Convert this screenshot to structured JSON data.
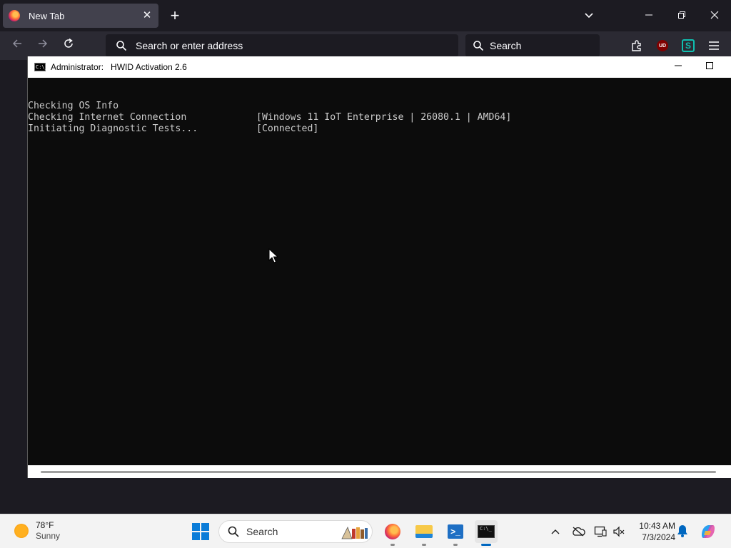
{
  "browser": {
    "tab_title": "New Tab",
    "url_placeholder": "Search or enter address",
    "search_placeholder": "Search",
    "ublock_label": "UD",
    "s_ext_label": "S"
  },
  "console": {
    "title_prefix": "Administrator:",
    "title": "HWID Activation 2.6",
    "icon_label": "C:\\_",
    "lines": [
      {
        "label": "Checking OS Info",
        "value": "[Windows 11 IoT Enterprise | 26080.1 | AMD64]"
      },
      {
        "label": "Checking Internet Connection",
        "value": "[Connected]"
      },
      {
        "label": "Initiating Diagnostic Tests...",
        "value": ""
      }
    ]
  },
  "taskbar": {
    "weather_temp": "78°F",
    "weather_cond": "Sunny",
    "search_label": "Search",
    "time": "10:43 AM",
    "date": "7/3/2024",
    "powershell_label": ">_",
    "terminal_label": "C:\\_"
  },
  "colors": {
    "console_bg": "#0c0c0c",
    "console_text": "#cccccc",
    "browser_bg": "#1c1b22",
    "accent": "#0067c0"
  }
}
